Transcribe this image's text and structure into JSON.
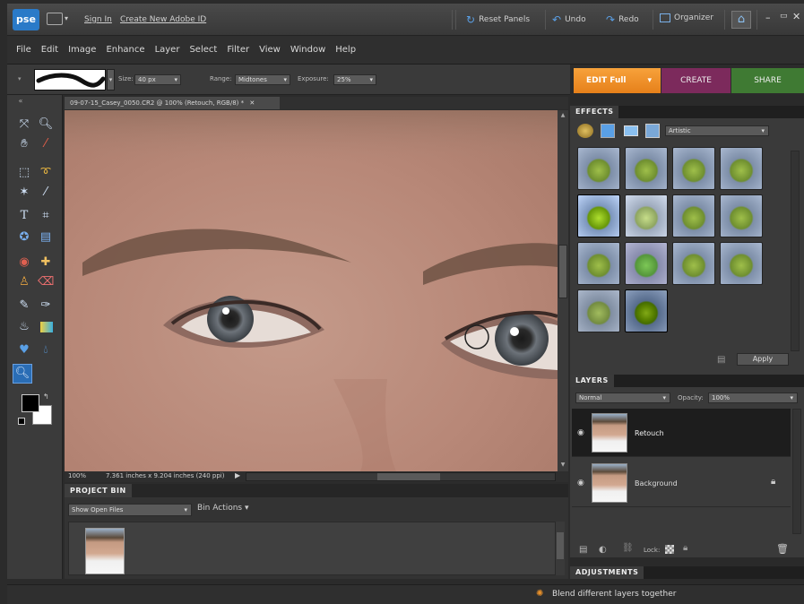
{
  "titlebar": {
    "logo": "pse",
    "sign_in": "Sign In",
    "create_id": "Create New Adobe ID",
    "reset_panels": "Reset Panels",
    "undo": "Undo",
    "redo": "Redo",
    "organizer": "Organizer"
  },
  "menu": [
    "File",
    "Edit",
    "Image",
    "Enhance",
    "Layer",
    "Select",
    "Filter",
    "View",
    "Window",
    "Help"
  ],
  "options": {
    "size_label": "Size:",
    "size_value": "40 px",
    "range_label": "Range:",
    "range_value": "Midtones",
    "exposure_label": "Exposure:",
    "exposure_value": "25%"
  },
  "modes": {
    "edit": "EDIT Full",
    "create": "CREATE",
    "share": "SHARE"
  },
  "document": {
    "tab_title": "09-07-15_Casey_0050.CR2 @ 100% (Retouch, RGB/8) *",
    "zoom": "100%",
    "dimensions": "7.361 inches x 9.204 inches (240 ppi)"
  },
  "project_bin": {
    "title": "PROJECT BIN",
    "show_select": "Show Open Files",
    "bin_actions": "Bin Actions"
  },
  "effects": {
    "title": "EFFECTS",
    "category": "Artistic",
    "apply": "Apply"
  },
  "layers": {
    "title": "LAYERS",
    "blend_mode": "Normal",
    "opacity_label": "Opacity:",
    "opacity_value": "100%",
    "items": [
      {
        "name": "Retouch"
      },
      {
        "name": "Background"
      }
    ],
    "lock_label": "Lock:"
  },
  "adjustments": {
    "title": "ADJUSTMENTS"
  },
  "status": {
    "hint": "Blend different layers together"
  }
}
